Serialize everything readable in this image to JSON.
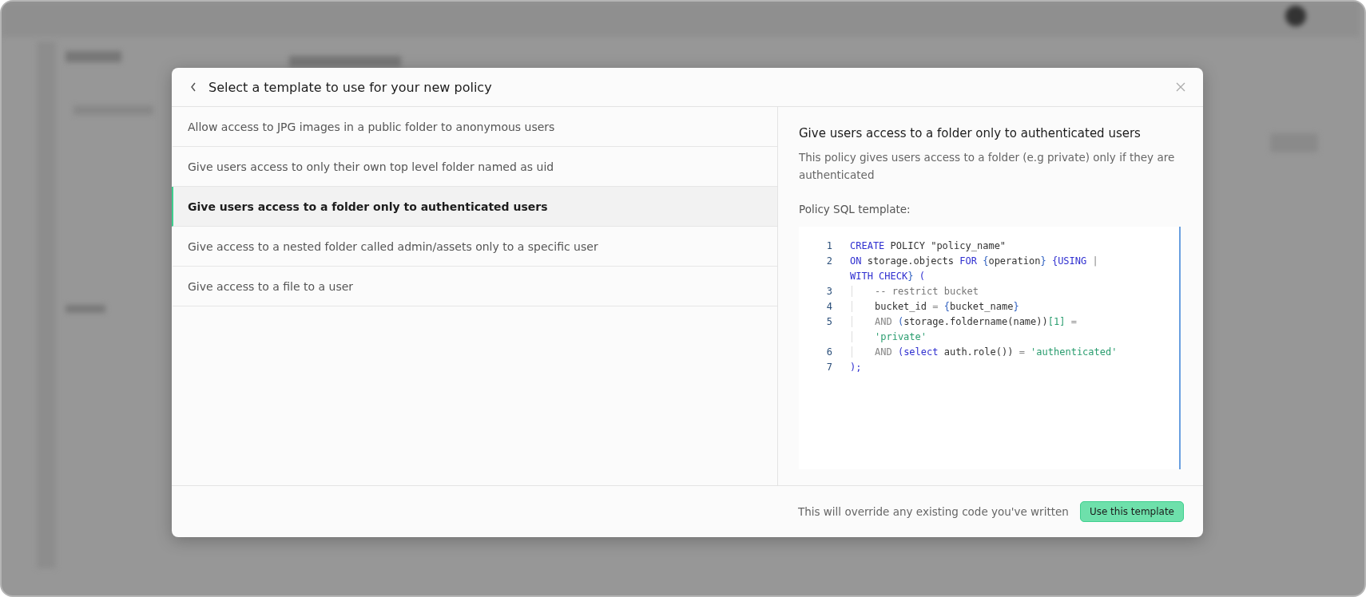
{
  "dialog": {
    "title": "Select a template to use for your new policy",
    "templates": [
      {
        "label": "Allow access to JPG images in a public folder to anonymous users",
        "selected": false
      },
      {
        "label": "Give users access to only their own top level folder named as uid",
        "selected": false
      },
      {
        "label": "Give users access to a folder only to authenticated users",
        "selected": true
      },
      {
        "label": "Give access to a nested folder called admin/assets only to a specific user",
        "selected": false
      },
      {
        "label": "Give access to a file to a user",
        "selected": false
      }
    ],
    "detail": {
      "heading": "Give users access to a folder only to authenticated users",
      "description": "This policy gives users access to a folder (e.g private) only if they are authenticated",
      "code_label": "Policy SQL template:",
      "code_rows": [
        {
          "number": "1",
          "indented": false,
          "tokens": [
            {
              "text": "CREATE",
              "kind": "keyword"
            },
            {
              "text": " POLICY \"policy_name\"",
              "kind": "text"
            }
          ]
        },
        {
          "number": "2",
          "indented": false,
          "tokens": [
            {
              "text": "ON",
              "kind": "keyword"
            },
            {
              "text": " storage.objects ",
              "kind": "text"
            },
            {
              "text": "FOR",
              "kind": "keyword"
            },
            {
              "text": " {",
              "kind": "brace"
            },
            {
              "text": "operation",
              "kind": "text"
            },
            {
              "text": "} ",
              "kind": "brace"
            },
            {
              "text": "{USING",
              "kind": "keyword"
            },
            {
              "text": " |",
              "kind": "op"
            }
          ]
        },
        {
          "indented": false,
          "tokens": [
            {
              "text": "WITH CHECK",
              "kind": "keyword"
            },
            {
              "text": "}",
              "kind": "brace"
            },
            {
              "text": " (",
              "kind": "keyword"
            }
          ]
        },
        {
          "number": "3",
          "indented": true,
          "tokens": [
            {
              "text": "-- restrict bucket",
              "kind": "comment"
            }
          ]
        },
        {
          "number": "4",
          "indented": true,
          "tokens": [
            {
              "text": "bucket_id ",
              "kind": "text"
            },
            {
              "text": "= ",
              "kind": "op"
            },
            {
              "text": "{",
              "kind": "brace"
            },
            {
              "text": "bucket_name",
              "kind": "text"
            },
            {
              "text": "}",
              "kind": "brace"
            }
          ]
        },
        {
          "number": "5",
          "indented": true,
          "tokens": [
            {
              "text": "AND ",
              "kind": "op"
            },
            {
              "text": "(",
              "kind": "brace"
            },
            {
              "text": "storage.foldername(name))",
              "kind": "text"
            },
            {
              "text": "[1]",
              "kind": "string"
            },
            {
              "text": " =",
              "kind": "op"
            }
          ]
        },
        {
          "indented": true,
          "tokens": [
            {
              "text": "'private'",
              "kind": "string"
            }
          ]
        },
        {
          "number": "6",
          "indented": true,
          "tokens": [
            {
              "text": "AND ",
              "kind": "op"
            },
            {
              "text": "(select",
              "kind": "keyword"
            },
            {
              "text": " auth.role()) ",
              "kind": "text"
            },
            {
              "text": "= ",
              "kind": "op"
            },
            {
              "text": "'authenticated'",
              "kind": "string"
            }
          ]
        },
        {
          "number": "7",
          "indented": false,
          "tokens": [
            {
              "text": ");",
              "kind": "keyword"
            }
          ]
        }
      ]
    },
    "footer": {
      "note": "This will override any existing code you've written",
      "button": "Use this template"
    }
  }
}
